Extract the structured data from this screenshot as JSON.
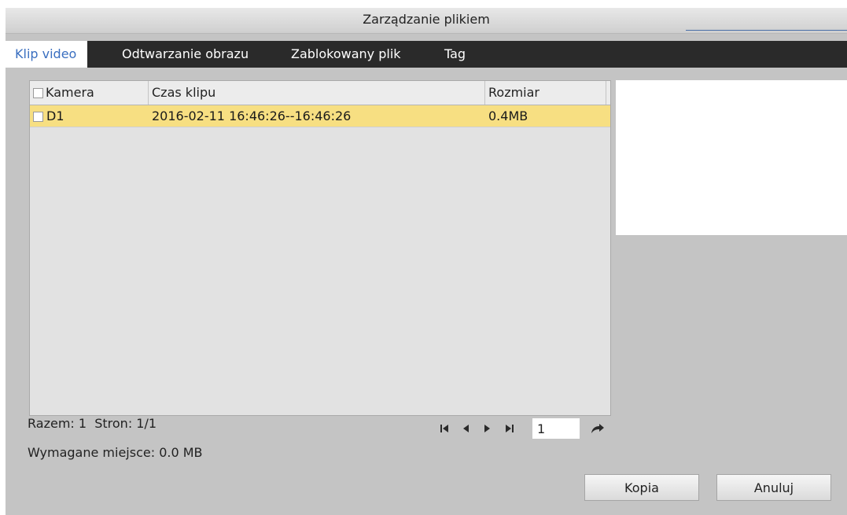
{
  "dialog": {
    "title": "Zarządzanie plikiem"
  },
  "tabs": [
    {
      "label": "Klip video",
      "active": true
    },
    {
      "label": "Odtwarzanie obrazu",
      "active": false
    },
    {
      "label": "Zablokowany plik",
      "active": false
    },
    {
      "label": "Tag",
      "active": false
    }
  ],
  "table": {
    "columns": [
      "Kamera",
      "Czas klipu",
      "Rozmiar"
    ],
    "rows": [
      {
        "camera": "D1",
        "time": "2016-02-11 16:46:26--16:46:26",
        "size": "0.4MB",
        "checked": false,
        "selected": true
      }
    ]
  },
  "footer": {
    "stats": "Razem: 1  Stron: 1/1",
    "required_space": "Wymagane miejsce: 0.0 MB",
    "page_value": "1"
  },
  "buttons": {
    "copy": "Kopia",
    "cancel": "Anuluj"
  },
  "colors": {
    "selected_row": "#f7df82",
    "tab_active_text": "#3a6fc0",
    "tabbar_bg": "#2a2a2a",
    "dialog_bg": "#c4c4c4"
  },
  "icons": {
    "first": "skip-first-icon",
    "prev": "prev-icon",
    "next": "next-icon",
    "last": "skip-last-icon",
    "go": "go-arrow-icon"
  }
}
